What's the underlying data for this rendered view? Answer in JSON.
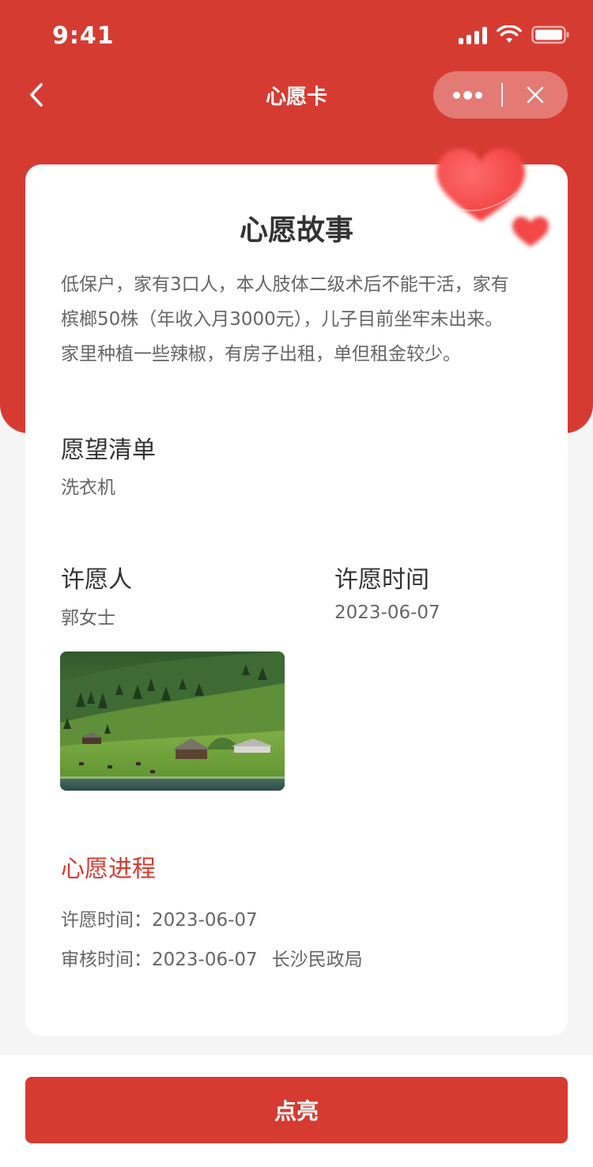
{
  "status_bar": {
    "time": "9:41"
  },
  "nav": {
    "title": "心愿卡"
  },
  "colors": {
    "primary": "#d63b32",
    "background": "#f5f5f5",
    "card": "#ffffff"
  },
  "story": {
    "title": "心愿故事",
    "lines": [
      "低保户，家有3口人，本人肢体二级术后不能干活，家有",
      "槟榔50株（年收入月3000元），儿子目前坐牢未出来。",
      "家里种植一些辣椒，有房子出租，单但租金较少。"
    ]
  },
  "wishlist": {
    "heading": "愿望清单",
    "value": "洗衣机"
  },
  "wisher": {
    "heading": "许愿人",
    "value": "郭女士"
  },
  "wish_time": {
    "heading": "许愿时间",
    "value": "2023-06-07"
  },
  "progress": {
    "heading": "心愿进程",
    "rows": [
      {
        "label": "许愿时间：",
        "date": "2023-06-07",
        "org": ""
      },
      {
        "label": "审核时间：",
        "date": "2023-06-07",
        "org": "长沙民政局"
      }
    ]
  },
  "footer": {
    "button_label": "点亮"
  },
  "icons": [
    "back-chevron-icon",
    "more-dots-icon",
    "close-icon",
    "signal-icon",
    "wifi-icon",
    "battery-icon",
    "heart-decoration-icon"
  ]
}
